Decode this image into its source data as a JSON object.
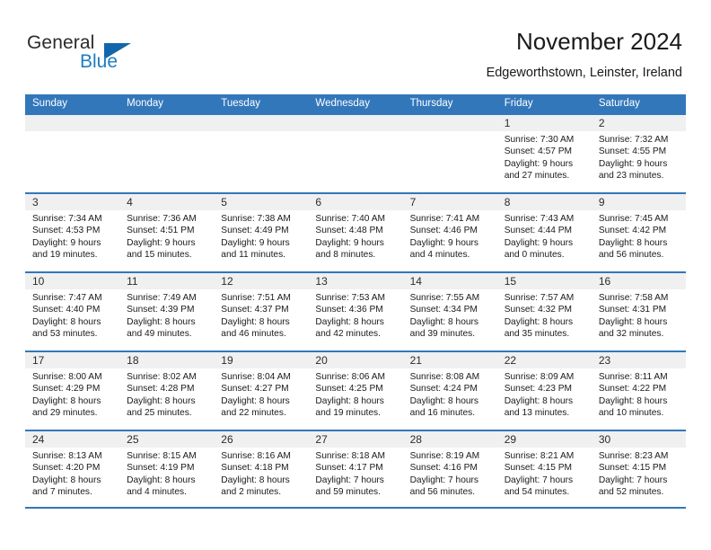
{
  "logo": {
    "word_one": "General",
    "word_two": "Blue",
    "triangle_icon": "triangle-icon"
  },
  "header": {
    "title": "November 2024",
    "subtitle": "Edgeworthstown, Leinster, Ireland"
  },
  "colors": {
    "header_blue": "#3377bb",
    "daynum_gray": "#f0f0f0",
    "logo_blue": "#1d7dc2",
    "logo_triangle": "#1266ab"
  },
  "calendar": {
    "weekdays": [
      "Sunday",
      "Monday",
      "Tuesday",
      "Wednesday",
      "Thursday",
      "Friday",
      "Saturday"
    ],
    "weeks": [
      [
        {
          "day": "",
          "sunrise": "",
          "sunset": "",
          "daylight1": "",
          "daylight2": ""
        },
        {
          "day": "",
          "sunrise": "",
          "sunset": "",
          "daylight1": "",
          "daylight2": ""
        },
        {
          "day": "",
          "sunrise": "",
          "sunset": "",
          "daylight1": "",
          "daylight2": ""
        },
        {
          "day": "",
          "sunrise": "",
          "sunset": "",
          "daylight1": "",
          "daylight2": ""
        },
        {
          "day": "",
          "sunrise": "",
          "sunset": "",
          "daylight1": "",
          "daylight2": ""
        },
        {
          "day": "1",
          "sunrise": "Sunrise: 7:30 AM",
          "sunset": "Sunset: 4:57 PM",
          "daylight1": "Daylight: 9 hours",
          "daylight2": "and 27 minutes."
        },
        {
          "day": "2",
          "sunrise": "Sunrise: 7:32 AM",
          "sunset": "Sunset: 4:55 PM",
          "daylight1": "Daylight: 9 hours",
          "daylight2": "and 23 minutes."
        }
      ],
      [
        {
          "day": "3",
          "sunrise": "Sunrise: 7:34 AM",
          "sunset": "Sunset: 4:53 PM",
          "daylight1": "Daylight: 9 hours",
          "daylight2": "and 19 minutes."
        },
        {
          "day": "4",
          "sunrise": "Sunrise: 7:36 AM",
          "sunset": "Sunset: 4:51 PM",
          "daylight1": "Daylight: 9 hours",
          "daylight2": "and 15 minutes."
        },
        {
          "day": "5",
          "sunrise": "Sunrise: 7:38 AM",
          "sunset": "Sunset: 4:49 PM",
          "daylight1": "Daylight: 9 hours",
          "daylight2": "and 11 minutes."
        },
        {
          "day": "6",
          "sunrise": "Sunrise: 7:40 AM",
          "sunset": "Sunset: 4:48 PM",
          "daylight1": "Daylight: 9 hours",
          "daylight2": "and 8 minutes."
        },
        {
          "day": "7",
          "sunrise": "Sunrise: 7:41 AM",
          "sunset": "Sunset: 4:46 PM",
          "daylight1": "Daylight: 9 hours",
          "daylight2": "and 4 minutes."
        },
        {
          "day": "8",
          "sunrise": "Sunrise: 7:43 AM",
          "sunset": "Sunset: 4:44 PM",
          "daylight1": "Daylight: 9 hours",
          "daylight2": "and 0 minutes."
        },
        {
          "day": "9",
          "sunrise": "Sunrise: 7:45 AM",
          "sunset": "Sunset: 4:42 PM",
          "daylight1": "Daylight: 8 hours",
          "daylight2": "and 56 minutes."
        }
      ],
      [
        {
          "day": "10",
          "sunrise": "Sunrise: 7:47 AM",
          "sunset": "Sunset: 4:40 PM",
          "daylight1": "Daylight: 8 hours",
          "daylight2": "and 53 minutes."
        },
        {
          "day": "11",
          "sunrise": "Sunrise: 7:49 AM",
          "sunset": "Sunset: 4:39 PM",
          "daylight1": "Daylight: 8 hours",
          "daylight2": "and 49 minutes."
        },
        {
          "day": "12",
          "sunrise": "Sunrise: 7:51 AM",
          "sunset": "Sunset: 4:37 PM",
          "daylight1": "Daylight: 8 hours",
          "daylight2": "and 46 minutes."
        },
        {
          "day": "13",
          "sunrise": "Sunrise: 7:53 AM",
          "sunset": "Sunset: 4:36 PM",
          "daylight1": "Daylight: 8 hours",
          "daylight2": "and 42 minutes."
        },
        {
          "day": "14",
          "sunrise": "Sunrise: 7:55 AM",
          "sunset": "Sunset: 4:34 PM",
          "daylight1": "Daylight: 8 hours",
          "daylight2": "and 39 minutes."
        },
        {
          "day": "15",
          "sunrise": "Sunrise: 7:57 AM",
          "sunset": "Sunset: 4:32 PM",
          "daylight1": "Daylight: 8 hours",
          "daylight2": "and 35 minutes."
        },
        {
          "day": "16",
          "sunrise": "Sunrise: 7:58 AM",
          "sunset": "Sunset: 4:31 PM",
          "daylight1": "Daylight: 8 hours",
          "daylight2": "and 32 minutes."
        }
      ],
      [
        {
          "day": "17",
          "sunrise": "Sunrise: 8:00 AM",
          "sunset": "Sunset: 4:29 PM",
          "daylight1": "Daylight: 8 hours",
          "daylight2": "and 29 minutes."
        },
        {
          "day": "18",
          "sunrise": "Sunrise: 8:02 AM",
          "sunset": "Sunset: 4:28 PM",
          "daylight1": "Daylight: 8 hours",
          "daylight2": "and 25 minutes."
        },
        {
          "day": "19",
          "sunrise": "Sunrise: 8:04 AM",
          "sunset": "Sunset: 4:27 PM",
          "daylight1": "Daylight: 8 hours",
          "daylight2": "and 22 minutes."
        },
        {
          "day": "20",
          "sunrise": "Sunrise: 8:06 AM",
          "sunset": "Sunset: 4:25 PM",
          "daylight1": "Daylight: 8 hours",
          "daylight2": "and 19 minutes."
        },
        {
          "day": "21",
          "sunrise": "Sunrise: 8:08 AM",
          "sunset": "Sunset: 4:24 PM",
          "daylight1": "Daylight: 8 hours",
          "daylight2": "and 16 minutes."
        },
        {
          "day": "22",
          "sunrise": "Sunrise: 8:09 AM",
          "sunset": "Sunset: 4:23 PM",
          "daylight1": "Daylight: 8 hours",
          "daylight2": "and 13 minutes."
        },
        {
          "day": "23",
          "sunrise": "Sunrise: 8:11 AM",
          "sunset": "Sunset: 4:22 PM",
          "daylight1": "Daylight: 8 hours",
          "daylight2": "and 10 minutes."
        }
      ],
      [
        {
          "day": "24",
          "sunrise": "Sunrise: 8:13 AM",
          "sunset": "Sunset: 4:20 PM",
          "daylight1": "Daylight: 8 hours",
          "daylight2": "and 7 minutes."
        },
        {
          "day": "25",
          "sunrise": "Sunrise: 8:15 AM",
          "sunset": "Sunset: 4:19 PM",
          "daylight1": "Daylight: 8 hours",
          "daylight2": "and 4 minutes."
        },
        {
          "day": "26",
          "sunrise": "Sunrise: 8:16 AM",
          "sunset": "Sunset: 4:18 PM",
          "daylight1": "Daylight: 8 hours",
          "daylight2": "and 2 minutes."
        },
        {
          "day": "27",
          "sunrise": "Sunrise: 8:18 AM",
          "sunset": "Sunset: 4:17 PM",
          "daylight1": "Daylight: 7 hours",
          "daylight2": "and 59 minutes."
        },
        {
          "day": "28",
          "sunrise": "Sunrise: 8:19 AM",
          "sunset": "Sunset: 4:16 PM",
          "daylight1": "Daylight: 7 hours",
          "daylight2": "and 56 minutes."
        },
        {
          "day": "29",
          "sunrise": "Sunrise: 8:21 AM",
          "sunset": "Sunset: 4:15 PM",
          "daylight1": "Daylight: 7 hours",
          "daylight2": "and 54 minutes."
        },
        {
          "day": "30",
          "sunrise": "Sunrise: 8:23 AM",
          "sunset": "Sunset: 4:15 PM",
          "daylight1": "Daylight: 7 hours",
          "daylight2": "and 52 minutes."
        }
      ]
    ]
  }
}
